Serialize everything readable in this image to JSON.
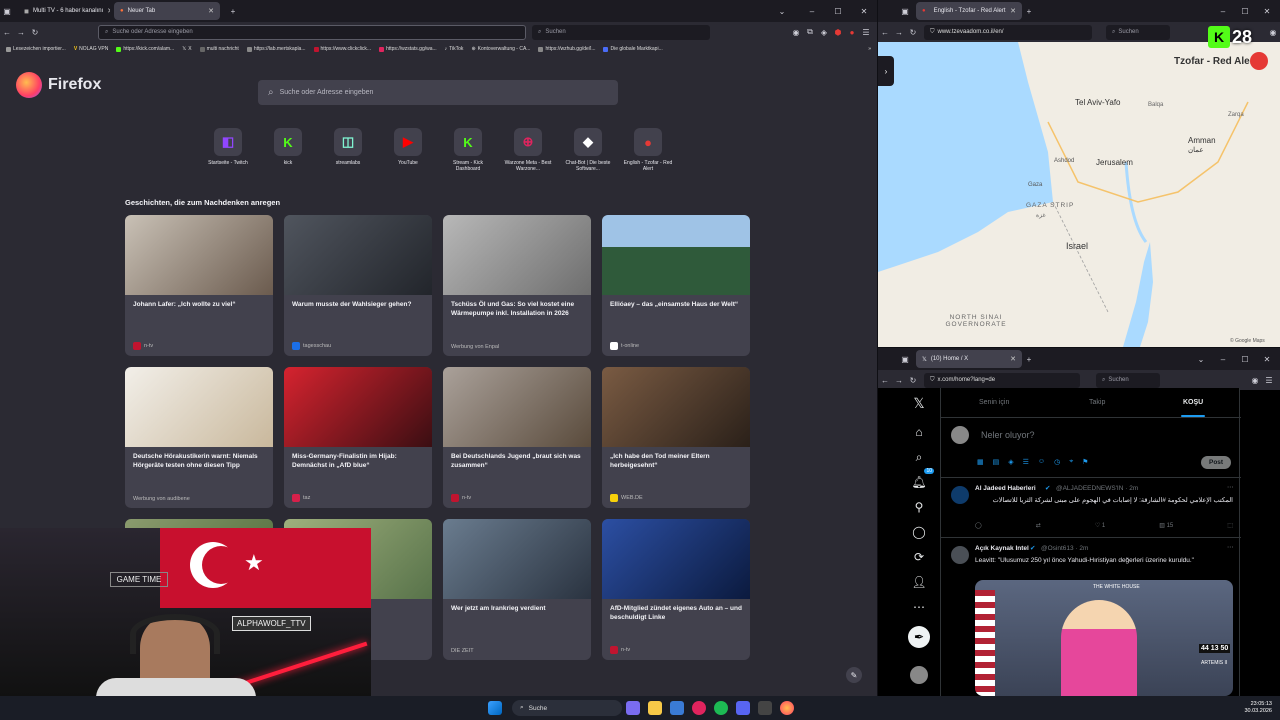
{
  "left_browser": {
    "tabs": [
      {
        "label": "Multi TV - 6 haber kanalını"
      },
      {
        "label": "Neuer Tab"
      }
    ],
    "url_placeholder": "Suche oder Adresse eingeben",
    "search_placeholder": "Suchen",
    "bookmarks": [
      "Lesezeichen importier...",
      "NOLAG VPN",
      "https://kick.com/alam...",
      "X",
      "multi nachricht",
      "https://lab.mertskapla...",
      "https://www.clickclick...",
      "https://wzstats.gg/wa...",
      "TikTok",
      "Kontoverwaltung - CA...",
      "https://wzhub.gg/de/l...",
      "Die globale Marktkapi..."
    ],
    "brand": "Firefox",
    "main_search_placeholder": "Suche oder Adresse eingeben",
    "shortcuts": [
      {
        "label": "Startseite - Twitch",
        "icon": "twitch-icon",
        "color": "#9146ff"
      },
      {
        "label": "kick",
        "icon": "kick-icon",
        "color": "#53fc18"
      },
      {
        "label": "streamlabs",
        "icon": "streamlabs-icon",
        "color": "#80f5d2"
      },
      {
        "label": "YouTube",
        "icon": "youtube-icon",
        "color": "#ff0000"
      },
      {
        "label": "Stream - Kick Dashboard",
        "icon": "kick-icon",
        "color": "#53fc18"
      },
      {
        "label": "Warzone Meta - Best Warzone...",
        "icon": "warzone-icon",
        "color": "#e0245e"
      },
      {
        "label": "Chat-Bot | Die beste Software...",
        "icon": "chatbot-icon",
        "color": "#ffffff"
      },
      {
        "label": "English - Tzofar - Red Alert",
        "icon": "tzofar-icon",
        "color": "#e53935"
      }
    ],
    "stories_heading": "Geschichten, die zum Nachdenken anregen",
    "stories": [
      {
        "title": "Johann Lafer: „Ich wollte zu viel“",
        "source": "n-tv",
        "fav": "#c0142f"
      },
      {
        "title": "Warum musste der Wahlsieger gehen?",
        "source": "tagesschau",
        "fav": "#1b6fe8"
      },
      {
        "title": "Tschüss Öl und Gas: So viel kostet eine Wärmepumpe inkl. Installation in 2026",
        "source": "Werbung von Enpal",
        "fav": ""
      },
      {
        "title": "Ellióaey – das „einsamste Haus der Welt“",
        "source": "t-online",
        "fav": "#ffffff"
      },
      {
        "title": "Deutsche Hörakustikerin warnt: Niemals Hörgeräte testen ohne diesen Tipp",
        "source": "Werbung von audibene",
        "fav": ""
      },
      {
        "title": "Miss-Germany-Finalistin im Hijab: Demnächst in „AfD blue“",
        "source": "taz",
        "fav": "#d6204a"
      },
      {
        "title": "Bei Deutschlands Jugend „braut sich was zusammen“",
        "source": "n-tv",
        "fav": "#c0142f"
      },
      {
        "title": "„Ich habe den Tod meiner Eltern herbeigesehnt“",
        "source": "WEB.DE",
        "fav": "#f7d10a"
      },
      {
        "title": "...ue Tierarten in ...chen Warnung",
        "source": "",
        "fav": ""
      },
      {
        "title": "",
        "source": "",
        "fav": ""
      },
      {
        "title": "Wer jetzt am Irankrieg verdient",
        "source": "DIE ZEIT",
        "fav": ""
      },
      {
        "title": "AfD-Mitglied zündet eigenes Auto an – und beschuldigt Linke",
        "source": "n-tv",
        "fav": "#c0142f"
      }
    ]
  },
  "map_window": {
    "tab_label": "English - Tzofar - Red Alert",
    "url": "www.tzevaadom.co.il/en/",
    "search_placeholder": "Suchen",
    "overlay_title": "Tzofar - Red Alert",
    "badge_count": "28",
    "places": [
      "Tel Aviv-Yafo",
      "Amman",
      "عمان",
      "Jerusalem",
      "Ashdod",
      "Gaza",
      "GAZA STRIP",
      "غزة",
      "Israel",
      "NORTH SINAI GOVERNORATE",
      "Balqa",
      "Zarqa"
    ],
    "attribution": "© Google Maps"
  },
  "x_window": {
    "tab_label": "(10) Home / X",
    "url": "x.com/home?lang=de",
    "search_placeholder": "Suchen",
    "tabs": [
      "Senin için",
      "Takip",
      "KOŞU"
    ],
    "compose_placeholder": "Neler oluyor?",
    "post_button": "Post",
    "notification_badge": "10",
    "tweets": [
      {
        "name": "Al Jadeed Haberleri",
        "handle": "@ALJADEEDNEWS'IN · 2m",
        "text": "المكتب الإعلامي لحكومة #الشارقة: لا إصابات في الهجوم على مبنى لشركة الثريا للاتصالات",
        "likes": "1",
        "views": "15"
      },
      {
        "name": "Açık Kaynak Intel",
        "handle": "@Osint613 · 2m",
        "text": "Leavitt: \"Ulusumuz 250 yıl önce Yahudi-Hıristiyan değerleri üzerine kuruldu.\""
      }
    ],
    "video_overlay": {
      "logo": "THE WHITE HOUSE",
      "clock": "44 13 50",
      "caption": "ARTEMIS II"
    }
  },
  "webcam_overlay": {
    "labels": [
      "ALPHAWOLF_TTV",
      "GAME TIME"
    ]
  },
  "taskbar": {
    "search_label": "Suche",
    "time": "23:05:13",
    "date": "30.03.2026"
  },
  "colors": {
    "ff_bg": "#2b2a33",
    "ff_card": "#42414d",
    "map_bg": "#f1ede4",
    "accent_red": "#e53935"
  }
}
